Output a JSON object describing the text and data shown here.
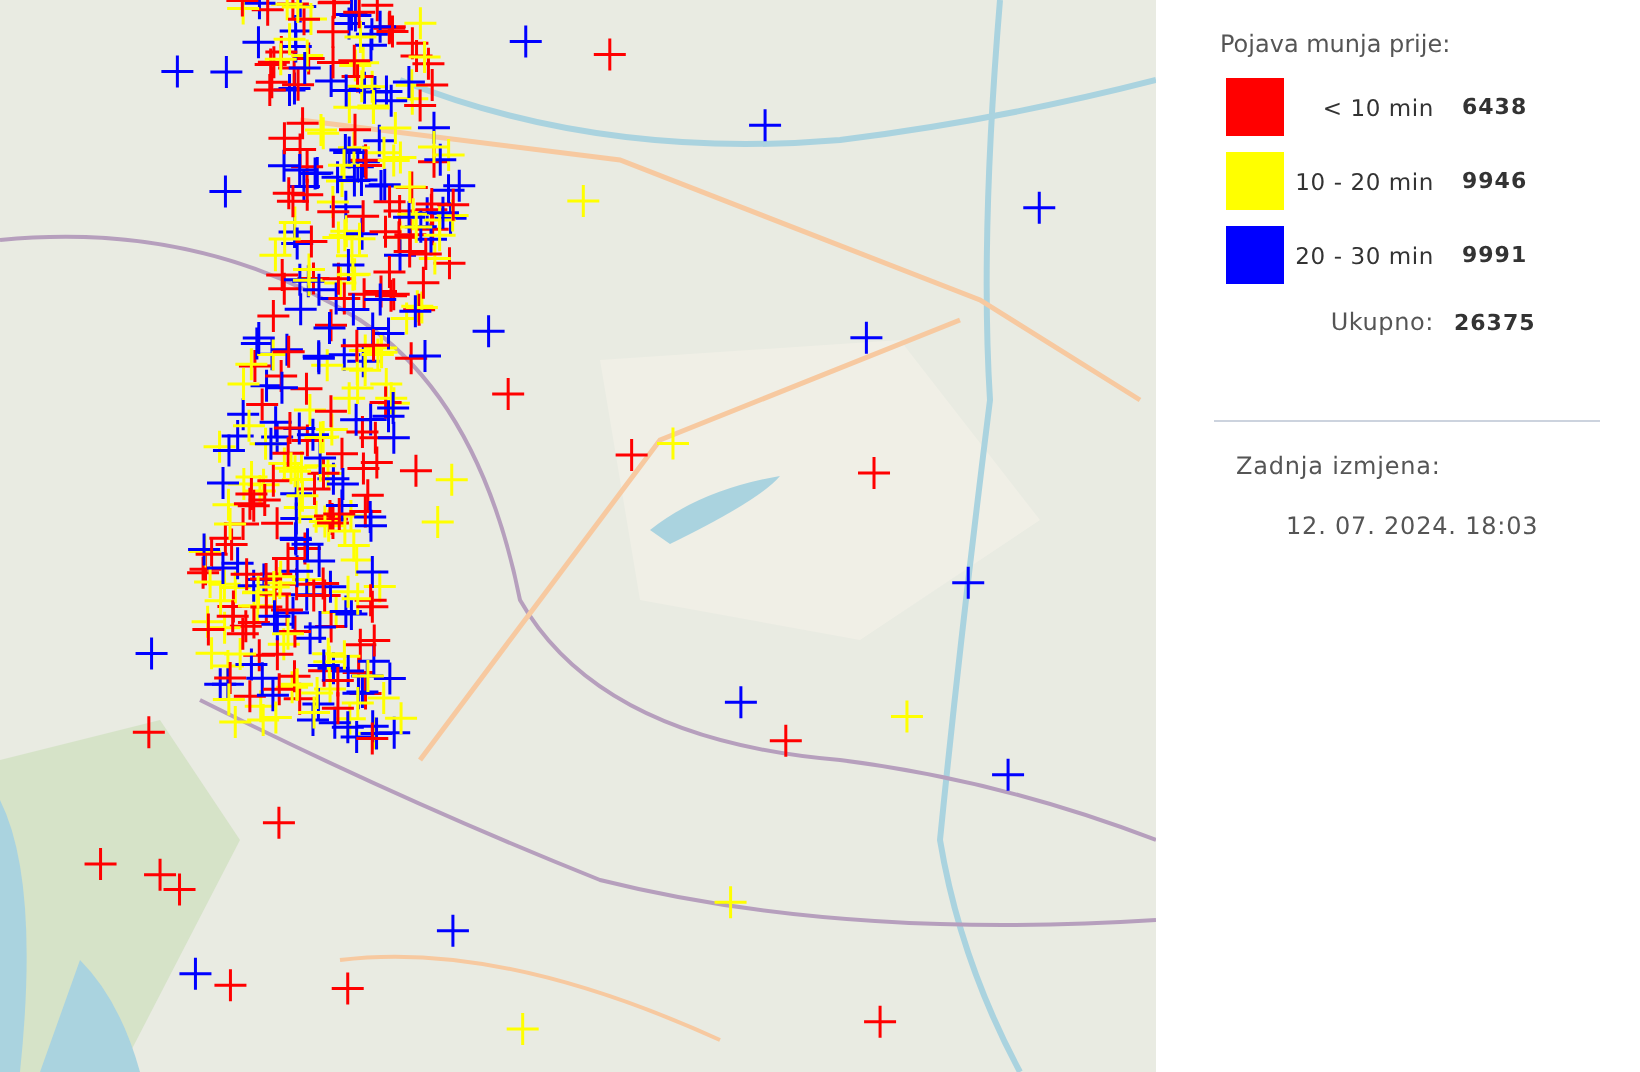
{
  "legend": {
    "title": "Pojava munja prije:",
    "items": [
      {
        "label": "< 10 min",
        "count": "6438",
        "color": "#ff0000"
      },
      {
        "label": "10 - 20 min",
        "count": "9946",
        "color": "#ffff00"
      },
      {
        "label": "20 - 30 min",
        "count": "9991",
        "color": "#0000ff"
      }
    ],
    "total_label": "Ukupno:",
    "total": "26375"
  },
  "last_update": {
    "label": "Zadnja izmjena:",
    "value": "12. 07. 2024. 18:03"
  }
}
